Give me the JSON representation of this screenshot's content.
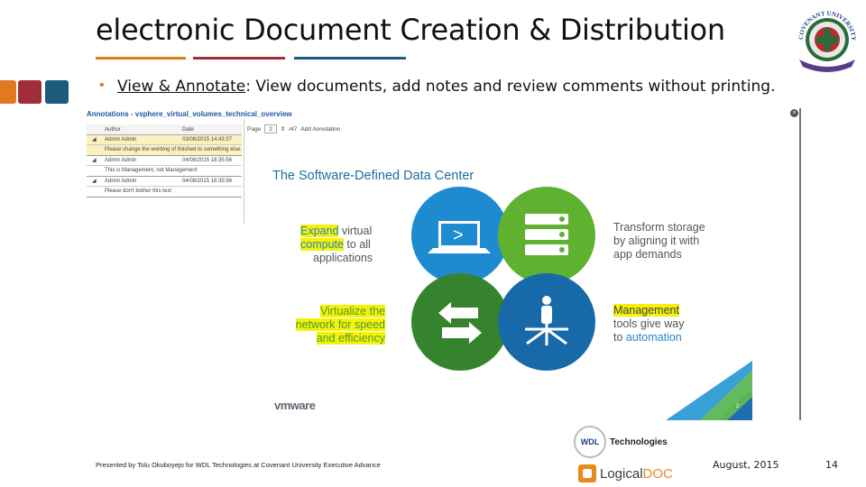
{
  "slide": {
    "title": "electronic Document Creation & Distribution",
    "bullet_marker": "•",
    "bullet_heading": "View & Annotate",
    "bullet_text": ": View documents, add notes and review comments without printing.",
    "page_number": "14",
    "date": "August, 2015",
    "footer_text": "Presented by Tolu Okuboyejo for WDL Technologies at Covenant University Executive Advance"
  },
  "logos": {
    "university": "COVENANT UNIVERSITY",
    "wdl_badge": "WDL",
    "wdl_name": "Technologies",
    "logicaldoc_part1": "Logical",
    "logicaldoc_part2": "DOC"
  },
  "viewer": {
    "panel_title": "Annotations - vsphere_virtual_volumes_technical_overview",
    "close_icon": "×",
    "columns": {
      "author": "Author",
      "date": "Date"
    },
    "annotations": [
      {
        "author": "Admin Admin",
        "date": "03/08/2015 14:43:37",
        "note": "Please change the wording of finished to something else.",
        "highlighted": true
      },
      {
        "author": "Admin Admin",
        "date": "04/08/2015 18:35:56",
        "note": "This is Management, not Management",
        "highlighted": false
      },
      {
        "author": "Admin Admin",
        "date": "04/08/2015 18:35:56",
        "note": "Please don't bother this text",
        "highlighted": false
      }
    ],
    "pager": {
      "label": "Page",
      "current": "2",
      "total": "/47",
      "add": "Add Annotation"
    }
  },
  "sddc": {
    "title": "The Software-Defined Data Center",
    "expand": {
      "w1": "Expand",
      "w2": " virtual",
      "w3": "compute",
      "w4": " to all",
      "w5": "applications"
    },
    "transform": {
      "l1": "Transform storage",
      "l2": "by aligning it with",
      "l3": "app demands"
    },
    "virtualize": {
      "l1": "Virtualize the",
      "l2a": "network",
      "l2b": " for speed",
      "l3": "and efficiency"
    },
    "management": {
      "w1": "Management",
      "l2": "tools give way",
      "l3a": "to ",
      "l3b": "automation"
    },
    "brand": "vmware",
    "page": "2",
    "icon_compute": "monitor-icon",
    "icon_storage": "server-stack-icon",
    "icon_network": "arrows-icon",
    "icon_management": "person-network-icon"
  },
  "colors": {
    "accent_orange": "#e07a1f",
    "accent_red": "#a12c3a",
    "accent_blue": "#1c5b7c",
    "vm_blue": "#1e8bd0",
    "vm_green": "#5fb130"
  }
}
